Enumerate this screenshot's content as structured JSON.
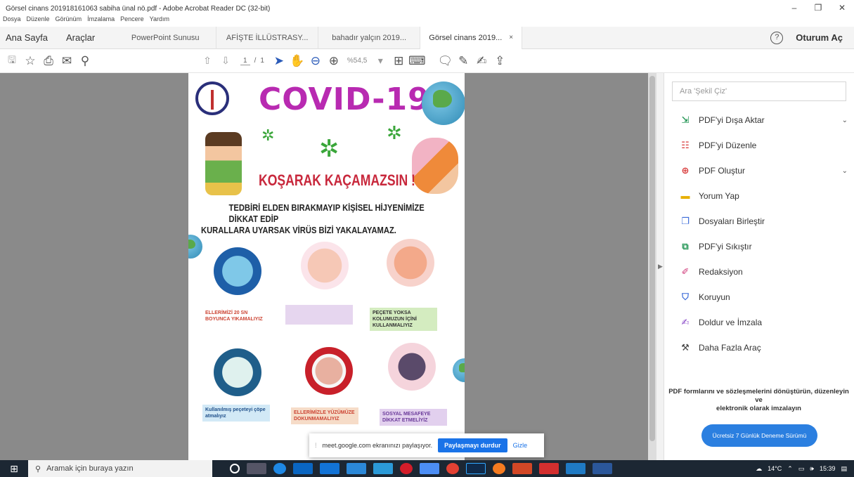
{
  "window": {
    "title": "Görsel cinans 201918161063 sabiha ünal nö.pdf - Adobe Acrobat Reader DC (32-bit)",
    "minimize": "–",
    "maximize": "❐",
    "close": "✕"
  },
  "menu": [
    "Dosya",
    "Düzenle",
    "Görünüm",
    "İmzalama",
    "Pencere",
    "Yardım"
  ],
  "tabs": {
    "home": "Ana Sayfa",
    "tools": "Araçlar",
    "docs": [
      "PowerPoint Sunusu",
      "AFİŞTE İLLÜSTRASY...",
      "bahadır yalçın 2019...",
      "Görsel cinans 2019..."
    ],
    "close_glyph": "×"
  },
  "account": {
    "help": "?",
    "signin": "Oturum Aç"
  },
  "toolbar": {
    "page_current": "1",
    "page_sep": "/",
    "page_total": "1",
    "zoom": "%54,5"
  },
  "poster": {
    "title": "COVID-19",
    "subtitle": "KOŞARAK KAÇAMAZSIN !",
    "line1": "TEDBİRİ ELDEN BIRAKMAYIP KİŞİSEL HİJYENİMİZE DİKKAT EDİP",
    "line2": "KURALLARA UYARSAK VİRÜS BİZİ YAKALAYAMAZ.",
    "captions": [
      "ELLERİMİZİ 20 SN BOYUNCA YIKAMALIYIZ",
      "",
      "PEÇETE YOKSA KOLUMUZUN İÇİNİ KULLANMALIYIZ",
      "Kullanılmış peçeteyi çöpe atmalıyız",
      "ELLERİMİZLE YÜZÜMÜZE DOKUNMAMALIYIZ",
      "SOSYAL MESAFEYE DİKKAT ETMELİYİZ"
    ]
  },
  "side": {
    "search_placeholder": "Ara 'Şekil Çiz'",
    "tools": [
      "PDF'yi Dışa Aktar",
      "PDF'yi Düzenle",
      "PDF Oluştur",
      "Yorum Yap",
      "Dosyaları Birleştir",
      "PDF'yi Sıkıştır",
      "Redaksiyon",
      "Koruyun",
      "Doldur ve İmzala",
      "Daha Fazla Araç"
    ],
    "promo_l1": "PDF formlarını ve sözleşmelerini dönüştürün, düzenleyin",
    "promo_l2": "ve",
    "promo_l3": "elektronik olarak imzalayın",
    "trial": "Ücretsiz 7 Günlük Deneme Sürümü"
  },
  "share": {
    "text": "meet.google.com ekranınızı paylaşıyor.",
    "stop": "Paylaşmayı durdur",
    "hide": "Gizle"
  },
  "taskbar": {
    "search_placeholder": "Aramak için buraya yazın",
    "weather": "14°C",
    "time": "15:39"
  }
}
